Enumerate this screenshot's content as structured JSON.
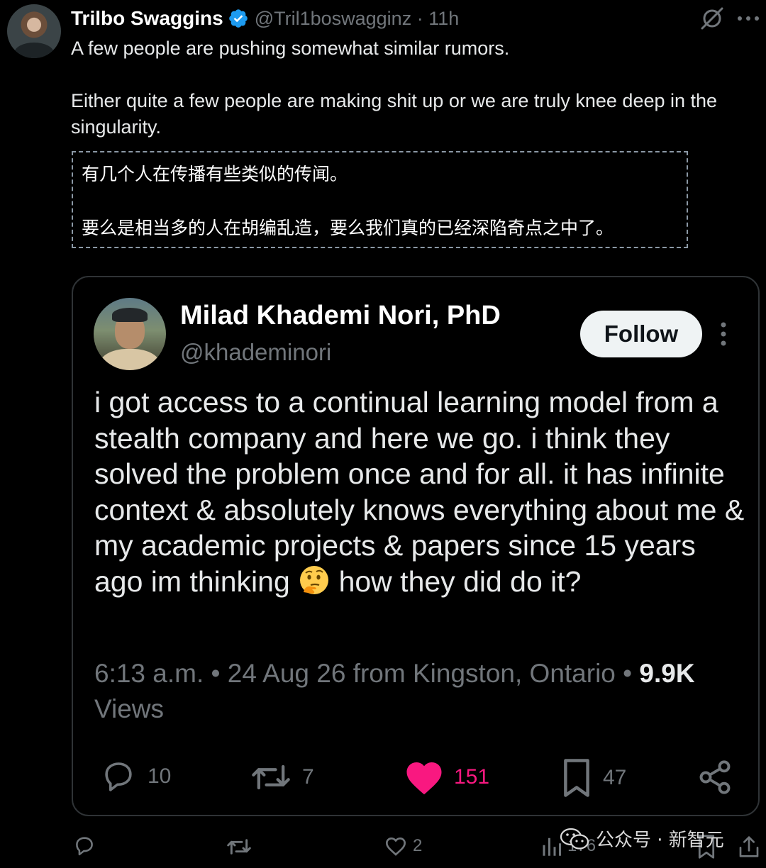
{
  "tweet": {
    "author_name": "Trilbo Swaggins",
    "handle_time": "@Tril1boswagginz · 11h",
    "text_line1": "A few people are pushing somewhat similar rumors.",
    "text_line2": "Either quite a few people are making shit up or we are truly knee deep in the singularity.",
    "translation_line1": "有几个人在传播有些类似的传闻。",
    "translation_line2": "要么是相当多的人在胡编乱造，要么我们真的已经深陷奇点之中了。"
  },
  "quote": {
    "author_name": "Milad Khademi Nori, PhD",
    "handle": "@khademinori",
    "follow_label": "Follow",
    "text_before_emoji": "i got access to a continual learning model from a stealth company and here we go. i think they solved the problem once and for all. it has infinite context & absolutely knows everything about me & my academic projects & papers since 15 years ago im thinking",
    "text_after_emoji": " how they did do it?",
    "meta_prefix": "6:13 a.m. • 24 Aug 26 from Kingston, Ontario • ",
    "views_count": "9.9K",
    "views_label": " Views",
    "actions": {
      "replies": "10",
      "reposts": "7",
      "likes": "151",
      "bookmarks": "47"
    }
  },
  "bottom_actions": {
    "likes": "2",
    "views": "176"
  },
  "watermark": {
    "text": "公众号 · 新智元"
  },
  "colors": {
    "background": "#000000",
    "text": "#e7e9ea",
    "muted": "#71767b",
    "like": "#f91880",
    "verified": "#1d9bf0"
  }
}
